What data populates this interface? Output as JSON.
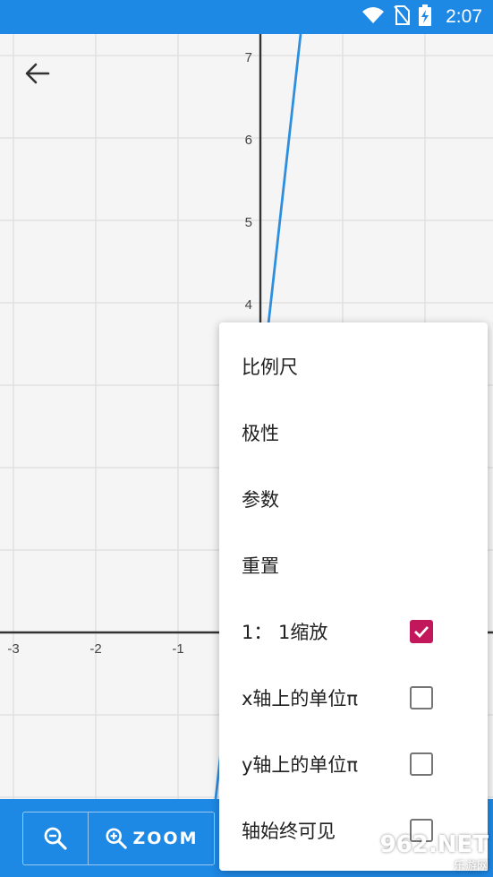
{
  "status_bar": {
    "time": "2:07",
    "icons": [
      "wifi-icon",
      "no-sim-icon",
      "battery-charging-icon"
    ]
  },
  "graph": {
    "x_ticks": [
      "-3",
      "-2",
      "-1"
    ],
    "y_ticks": [
      "4",
      "5",
      "6",
      "7"
    ],
    "curve_color": "#2f8fdf",
    "axis_color": "#333333",
    "grid_color": "#dddddd"
  },
  "toolbar": {
    "zoom_label": "ZOOM",
    "accent": "#1e88e5"
  },
  "menu": {
    "items": [
      {
        "label": "比例尺"
      },
      {
        "label": "极性"
      },
      {
        "label": "参数"
      },
      {
        "label": "重置"
      },
      {
        "label": "1： 1缩放",
        "checked": true
      },
      {
        "label": "x轴上的单位π",
        "checked": false
      },
      {
        "label": "y轴上的单位π",
        "checked": false
      },
      {
        "label": "轴始终可见",
        "checked": false
      }
    ],
    "check_color": "#c2185b"
  },
  "watermark": {
    "main": "962.NET",
    "sub": "乐游网"
  }
}
